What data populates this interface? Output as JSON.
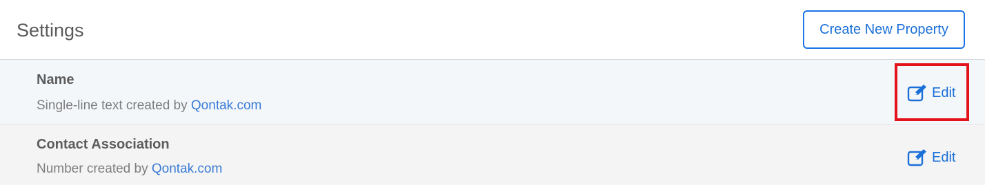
{
  "header": {
    "title": "Settings",
    "create_button_label": "Create New Property"
  },
  "properties": [
    {
      "name": "Name",
      "type_text": "Single-line text created by ",
      "creator": "Qontak.com",
      "edit_label": "Edit"
    },
    {
      "name": "Contact Association",
      "type_text": "Number created by ",
      "creator": "Qontak.com",
      "edit_label": "Edit"
    }
  ],
  "colors": {
    "accent": "#1a73e8",
    "highlight": "#e3121b",
    "row_bg_1": "#f4f7fa",
    "row_bg_2": "#f4f4f4"
  },
  "icons": {
    "edit": "edit-pencil-square-icon"
  }
}
